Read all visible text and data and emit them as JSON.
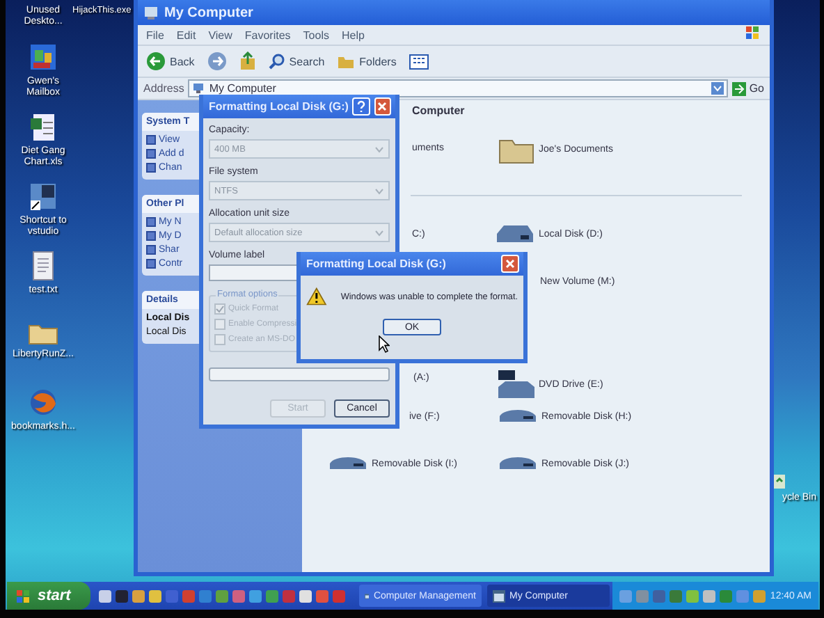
{
  "desktop_top_icon": {
    "label": "HijackThis.exe"
  },
  "desktop_icons": [
    {
      "label": "Unused Deskto...",
      "kind": "none"
    },
    {
      "label": "Gwen's Mailbox",
      "kind": "mailbox"
    },
    {
      "label": "Diet Gang Chart.xls",
      "kind": "spreadsheet"
    },
    {
      "label": "Shortcut to vstudio",
      "kind": "shortcut"
    },
    {
      "label": "test.txt",
      "kind": "text"
    },
    {
      "label": "LibertyRunZ...",
      "kind": "folder"
    },
    {
      "label": "bookmarks.h...",
      "kind": "browser"
    }
  ],
  "recycle_bin": {
    "label": "ycle Bin"
  },
  "explorer": {
    "title": "My Computer",
    "menu": [
      "File",
      "Edit",
      "View",
      "Favorites",
      "Tools",
      "Help"
    ],
    "toolbar": {
      "back": "Back",
      "search": "Search",
      "folders": "Folders"
    },
    "address": {
      "label": "Address",
      "value": "My Computer",
      "go": "Go"
    },
    "sidebar": [
      {
        "title": "System T",
        "items": [
          "View",
          "Add d",
          "Chan"
        ]
      },
      {
        "title": "Other Pl",
        "items": [
          "My N",
          "My D",
          "Shar",
          "Contr"
        ]
      },
      {
        "title": "Details",
        "items": [
          "Local Dis",
          "Local Dis"
        ]
      }
    ],
    "header": "Computer",
    "items": [
      {
        "label": "uments",
        "kind": "hidden"
      },
      {
        "label": "Joe's Documents",
        "kind": "folder"
      },
      {
        "label": "C:)",
        "kind": "hidden"
      },
      {
        "label": "Local Disk (D:)",
        "kind": "disk"
      },
      {
        "label": "New Volume (M:)",
        "kind": "hidden"
      },
      {
        "label": "(A:)",
        "kind": "hidden"
      },
      {
        "label": "DVD Drive (E:)",
        "kind": "dvd"
      },
      {
        "label": "ive (F:)",
        "kind": "hidden"
      },
      {
        "label": "Removable Disk (H:)",
        "kind": "removable"
      },
      {
        "label": "Removable Disk (I:)",
        "kind": "removable"
      },
      {
        "label": "Removable Disk (J:)",
        "kind": "removable"
      }
    ]
  },
  "format_dialog": {
    "title": "Formatting Local Disk (G:)",
    "fields": [
      {
        "label": "Capacity:",
        "value": "400 MB",
        "kind": "select"
      },
      {
        "label": "File system",
        "value": "NTFS",
        "kind": "select"
      },
      {
        "label": "Allocation unit size",
        "value": "Default allocation size",
        "kind": "select"
      },
      {
        "label": "Volume label",
        "kind": "text"
      }
    ],
    "options_title": "Format options",
    "options": [
      {
        "label": "Quick Format",
        "checked": true,
        "disabled": true
      },
      {
        "label": "Enable Compressi",
        "checked": false,
        "disabled": true
      },
      {
        "label": "Create an MS-DO",
        "checked": false,
        "disabled": true
      }
    ],
    "progress": {
      "level": 0
    },
    "buttons": [
      {
        "label": "Start",
        "disabled": true
      },
      {
        "label": "Cancel",
        "disabled": false
      }
    ]
  },
  "error_dialog": {
    "title": "Formatting Local Disk (G:)",
    "message": "Windows was unable to complete the format.",
    "button": "OK"
  },
  "taskbar": {
    "start": "start",
    "tasks": [
      {
        "label": "Computer Management",
        "selected": false
      },
      {
        "label": "My Computer",
        "selected": true
      }
    ],
    "clock": "12:40 AM"
  }
}
